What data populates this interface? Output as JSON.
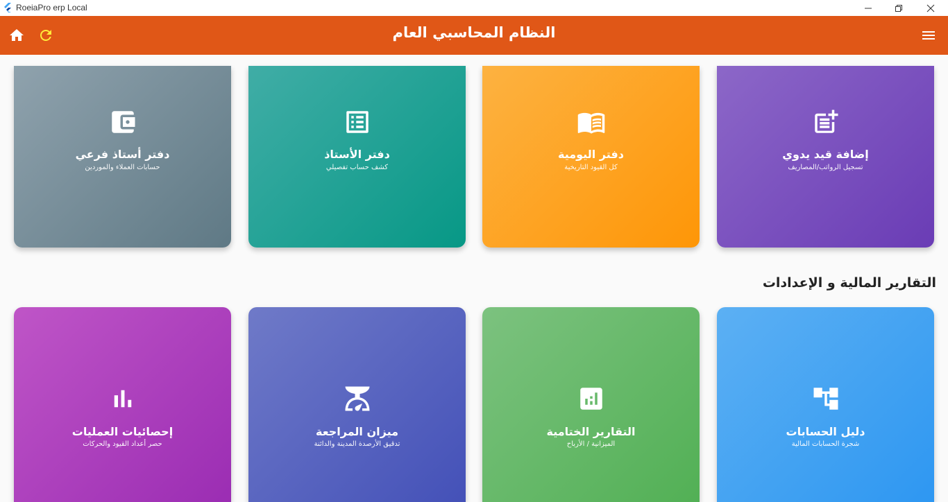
{
  "window": {
    "title": "RoeiaPro erp Local",
    "icons": {
      "logo": "flutter-logo-icon",
      "minimize": "minimize-icon",
      "maximize": "restore-icon",
      "close": "close-icon"
    }
  },
  "appbar": {
    "title": "النظام المحاسبي العام",
    "background": "#e05717",
    "icons": {
      "home": "home-icon",
      "refresh": "refresh-icon",
      "menu": "hamburger-menu-icon"
    },
    "refresh_color": "#ffeb3b"
  },
  "top_cards": [
    {
      "title": "دفتر أستاذ فرعي",
      "subtitle": "حسابات العملاء والموردين",
      "icon": "wallet-icon",
      "color": "#6f8894"
    },
    {
      "title": "دفتر الأستاذ",
      "subtitle": "كشف حساب تفصيلي",
      "icon": "list-alt-icon",
      "color": "#26a69a"
    },
    {
      "title": "دفتر اليومية",
      "subtitle": "كل القيود التاريخية",
      "icon": "open-book-icon",
      "color": "#ffa726"
    },
    {
      "title": "إضافة قيد يدوي",
      "subtitle": "تسجيل الرواتب/المصاريف",
      "icon": "post-add-icon",
      "color": "#7e57c2"
    }
  ],
  "section": {
    "title": "التقارير المالية و الإعدادات"
  },
  "bottom_cards": [
    {
      "title": "إحصائيات العمليات",
      "subtitle": "حصر أعداد القيود والحركات",
      "icon": "bar-chart-icon",
      "color": "#ab47bc"
    },
    {
      "title": "ميزان المراجعة",
      "subtitle": "تدقيق الأرصدة المدينة والدائنة",
      "icon": "scale-icon",
      "color": "#5c6bc0"
    },
    {
      "title": "التقارير الختامية",
      "subtitle": "الميزانية / الأرباح",
      "icon": "analytics-icon",
      "color": "#66bb6a"
    },
    {
      "title": "دليل الحسابات",
      "subtitle": "شجرة الحسابات المالية",
      "icon": "account-tree-icon",
      "color": "#42a5f5"
    }
  ]
}
